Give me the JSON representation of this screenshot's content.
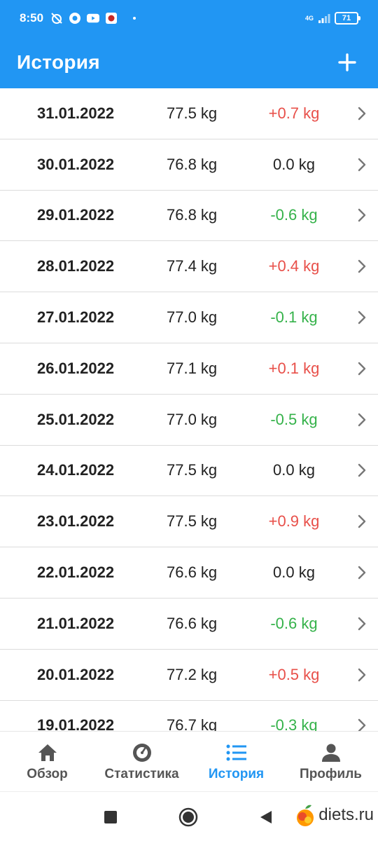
{
  "status_bar": {
    "time": "8:50",
    "network": "4G",
    "battery": "71"
  },
  "app_bar": {
    "title": "История",
    "add_icon": "plus-icon"
  },
  "colors": {
    "primary": "#2196f3",
    "gain": "#e8504a",
    "loss": "#35b24a",
    "neutral": "#222222"
  },
  "history": [
    {
      "date": "31.01.2022",
      "weight": "77.5 kg",
      "change": "+0.7 kg",
      "trend": "gain"
    },
    {
      "date": "30.01.2022",
      "weight": "76.8 kg",
      "change": "0.0 kg",
      "trend": "neutral"
    },
    {
      "date": "29.01.2022",
      "weight": "76.8 kg",
      "change": "-0.6 kg",
      "trend": "loss"
    },
    {
      "date": "28.01.2022",
      "weight": "77.4 kg",
      "change": "+0.4 kg",
      "trend": "gain"
    },
    {
      "date": "27.01.2022",
      "weight": "77.0 kg",
      "change": "-0.1 kg",
      "trend": "loss"
    },
    {
      "date": "26.01.2022",
      "weight": "77.1 kg",
      "change": "+0.1 kg",
      "trend": "gain"
    },
    {
      "date": "25.01.2022",
      "weight": "77.0 kg",
      "change": "-0.5 kg",
      "trend": "loss"
    },
    {
      "date": "24.01.2022",
      "weight": "77.5 kg",
      "change": "0.0 kg",
      "trend": "neutral"
    },
    {
      "date": "23.01.2022",
      "weight": "77.5 kg",
      "change": "+0.9 kg",
      "trend": "gain"
    },
    {
      "date": "22.01.2022",
      "weight": "76.6 kg",
      "change": "0.0 kg",
      "trend": "neutral"
    },
    {
      "date": "21.01.2022",
      "weight": "76.6 kg",
      "change": "-0.6 kg",
      "trend": "loss"
    },
    {
      "date": "20.01.2022",
      "weight": "77.2 kg",
      "change": "+0.5 kg",
      "trend": "gain"
    },
    {
      "date": "19.01.2022",
      "weight": "76.7 kg",
      "change": "-0.3 kg",
      "trend": "loss"
    }
  ],
  "bottom_nav": {
    "items": [
      {
        "label": "Обзор",
        "icon": "home-icon"
      },
      {
        "label": "Статистика",
        "icon": "scale-icon"
      },
      {
        "label": "История",
        "icon": "list-icon",
        "active": true
      },
      {
        "label": "Профиль",
        "icon": "person-icon"
      }
    ]
  },
  "watermark": {
    "text": "diets.ru"
  }
}
